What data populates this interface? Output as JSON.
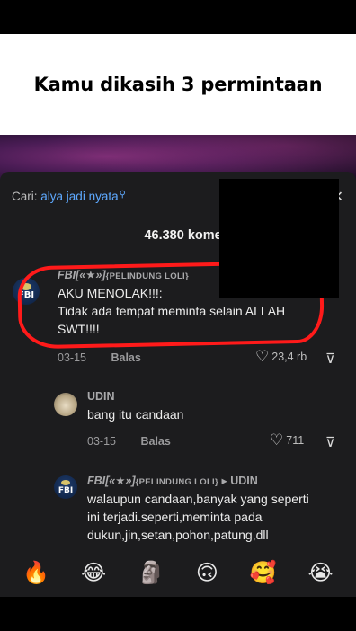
{
  "caption": "Kamu dikasih 3 permintaan",
  "search": {
    "prefix": "Cari:",
    "query": "alya jadi nyata",
    "icon": "search-icon"
  },
  "comment_count": "46.380 komen",
  "comments": [
    {
      "user_italic": "FBI",
      "user_mid": "[«★»]",
      "user_tag": "{PELINDUNG LOLI}",
      "lines": [
        "AKU MENOLAK!!!:",
        "Tidak ada tempat meminta selain ALLAH",
        "SWT!!!!"
      ],
      "date": "03-15",
      "reply_label": "Balas",
      "likes": "23,4 rb"
    },
    {
      "user": "UDIN",
      "lines": [
        "bang itu candaan"
      ],
      "date": "03-15",
      "reply_label": "Balas",
      "likes": "711"
    },
    {
      "user_italic": "FBI",
      "user_mid": "[«★»]",
      "user_tag": "{PELINDUNG LOLI}",
      "reply_arrow": "▸",
      "reply_to": "UDIN",
      "lines": [
        "walaupun candaan,banyak yang seperti",
        "ini terjadi.seperti,meminta pada",
        "dukun,jin,setan,pohon,patung,dll"
      ]
    }
  ],
  "avatar_label": "FBI",
  "emojis": [
    "🔥",
    "😂",
    "🗿",
    "🙃",
    "🥰",
    "😭"
  ],
  "colors": {
    "accent": "#5ea9ff",
    "highlight": "#ff1a1a",
    "sheet": "#1c1c1e"
  }
}
